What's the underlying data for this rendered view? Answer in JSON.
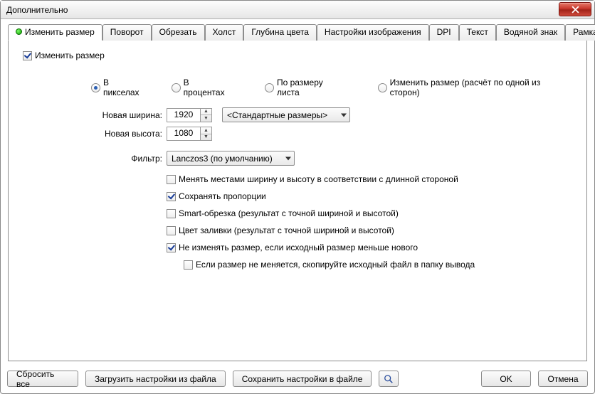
{
  "window": {
    "title": "Дополнительно"
  },
  "tabs": [
    "Изменить размер",
    "Поворот",
    "Обрезать",
    "Холст",
    "Глубина цвета",
    "Настройки изображения",
    "DPI",
    "Текст",
    "Водяной знак",
    "Рамка"
  ],
  "main": {
    "resize_checkbox": "Изменить размер",
    "mode": {
      "pixels": "В пикселах",
      "percent": "В процентах",
      "page": "По размеру листа",
      "by_side": "Изменить размер (расчёт по одной из сторон)"
    },
    "width_label": "Новая ширина:",
    "width_value": "1920",
    "height_label": "Новая высота:",
    "height_value": "1080",
    "std_sizes": "<Стандартные размеры>",
    "filter_label": "Фильтр:",
    "filter_value": "Lanczos3 (по умолчанию)",
    "opts": {
      "swap": "Менять местами ширину и высоту в соответствии с длинной стороной",
      "keep_aspect": "Сохранять пропорции",
      "smart_crop": "Smart-обрезка (результат с точной шириной и высотой)",
      "fill_color": "Цвет заливки (результат с точной шириной и высотой)",
      "no_upscale": "Не изменять размер, если исходный размер меньше нового",
      "copy_original": "Если размер не меняется, скопируйте исходный файл в папку вывода"
    }
  },
  "footer": {
    "reset": "Сбросить все",
    "load": "Загрузить настройки из файла",
    "save": "Сохранить настройки в файле",
    "ok": "OK",
    "cancel": "Отмена"
  }
}
